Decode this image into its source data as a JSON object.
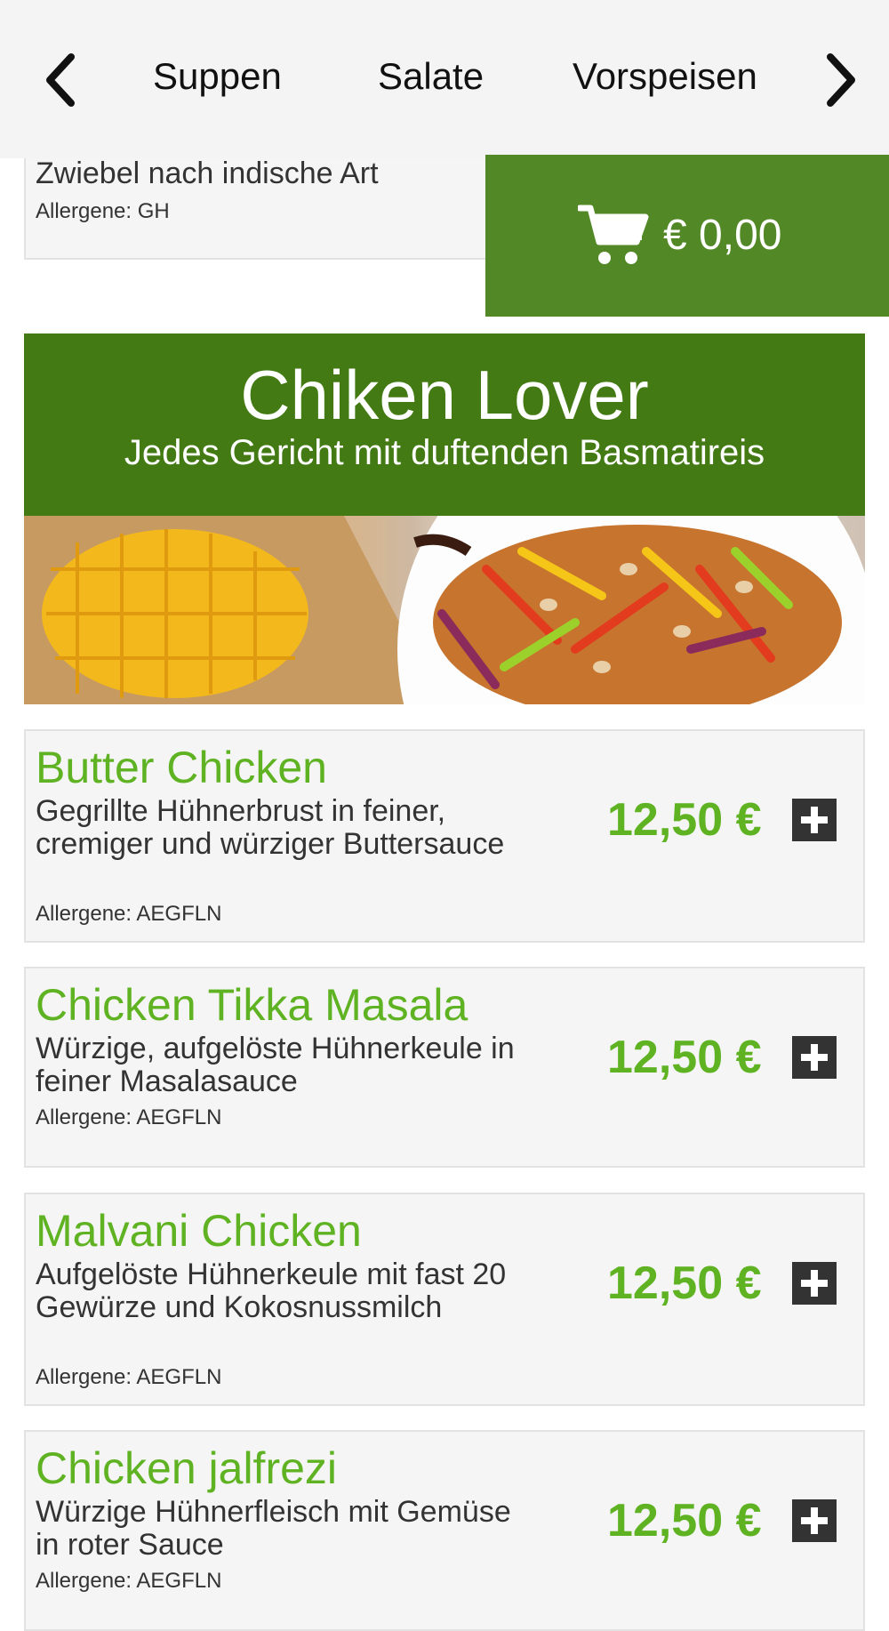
{
  "nav": {
    "prev_icon": "chevron-left-icon",
    "next_icon": "chevron-right-icon",
    "tabs": [
      "Suppen",
      "Salate",
      "Vorspeisen"
    ]
  },
  "prev_item": {
    "description": "Zwiebel nach indische Art",
    "allergens": "Allergene: GH"
  },
  "cart": {
    "icon": "shopping-cart-icon",
    "total": "€ 0,00",
    "color": "#538826"
  },
  "section": {
    "title": "Chiken Lover",
    "subtitle": "Jedes Gericht mit duftenden Basmatireis",
    "color": "#437a14"
  },
  "items": [
    {
      "name": "Butter Chicken",
      "description": "Gegrillte Hühnerbrust in feiner, cremiger und würziger Buttersauce",
      "allergens": "Allergene: AEGFLN",
      "price": "12,50 €"
    },
    {
      "name": "Chicken Tikka Masala",
      "description": "Würzige, aufgelöste Hühnerkeule in feiner Masalasauce",
      "allergens": "Allergene: AEGFLN",
      "price": "12,50 €"
    },
    {
      "name": "Malvani Chicken",
      "description": "Aufgelöste Hühnerkeule mit fast 20 Gewürze und Kokosnussmilch",
      "allergens": "Allergene: AEGFLN",
      "price": "12,50 €"
    },
    {
      "name": "Chicken jalfrezi",
      "description": "Würzige Hühnerfleisch mit Gemüse in roter Sauce",
      "allergens": "Allergene: AEGFLN",
      "price": "12,50 €"
    }
  ],
  "colors": {
    "accent_green": "#5fb322",
    "add_button": "#333333"
  }
}
